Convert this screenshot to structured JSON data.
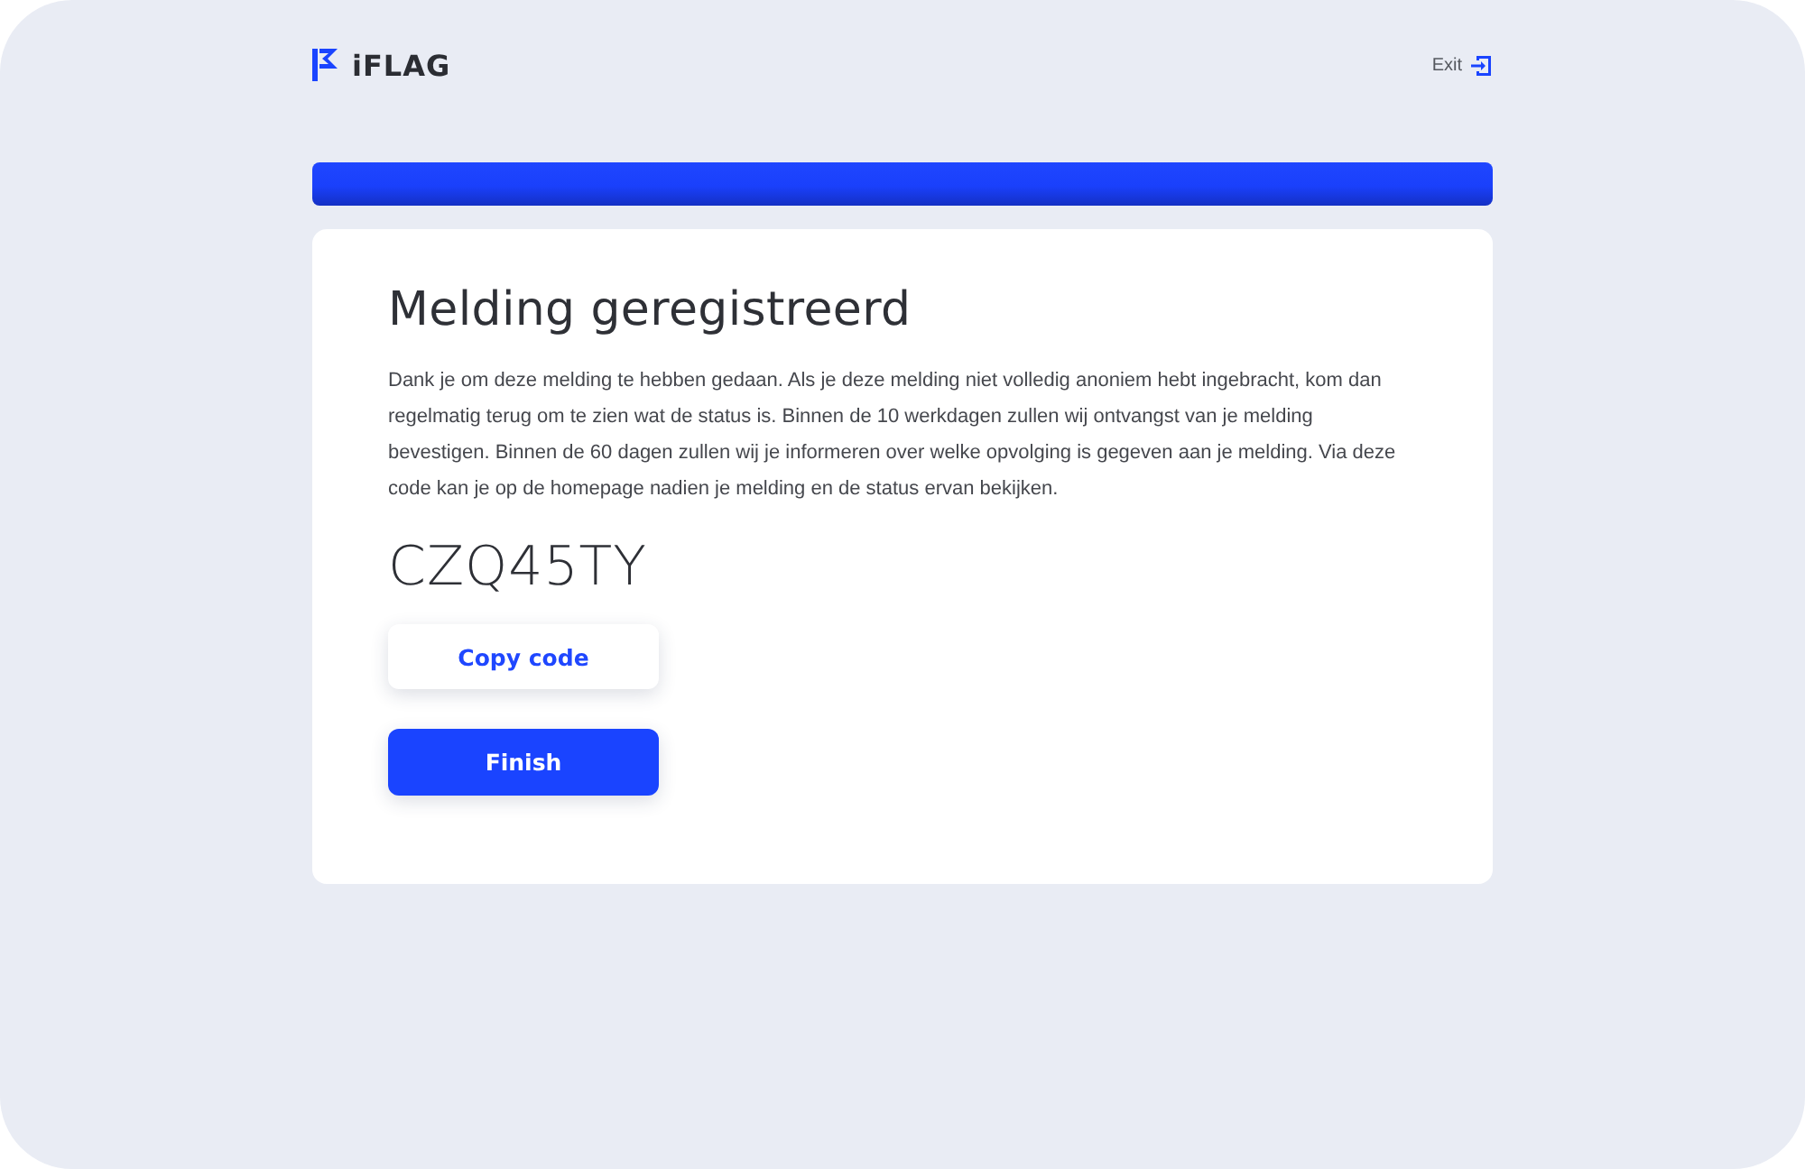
{
  "header": {
    "logo_text": "iFLAG",
    "exit_label": "Exit"
  },
  "card": {
    "title": "Melding geregistreerd",
    "message": "Dank je om deze melding te hebben gedaan. Als je deze melding niet volledig anoniem hebt ingebracht, kom dan regelmatig terug om te zien wat de status is. Binnen de 10 werkdagen zullen wij ontvangst van je melding bevestigen. Binnen de 60 dagen zullen wij je informeren over welke opvolging is gegeven aan je melding. Via deze code kan je op de homepage nadien je melding en de status ervan bekijken.",
    "code": "CZQ45TY",
    "buttons": [
      {
        "label": "Copy code",
        "kind": "secondary"
      },
      {
        "label": "Finish",
        "kind": "primary"
      }
    ]
  }
}
